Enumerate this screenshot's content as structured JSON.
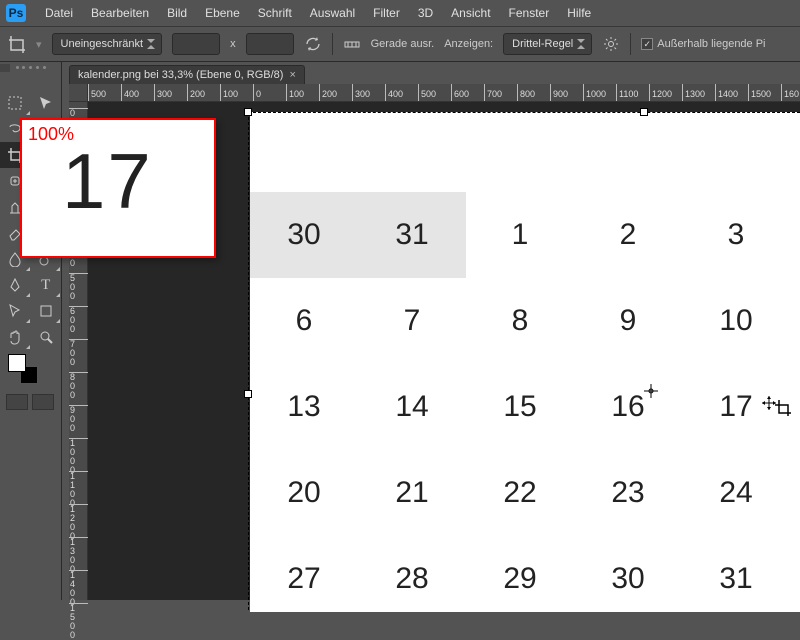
{
  "app_logo": "Ps",
  "menus": [
    "Datei",
    "Bearbeiten",
    "Bild",
    "Ebene",
    "Schrift",
    "Auswahl",
    "Filter",
    "3D",
    "Ansicht",
    "Fenster",
    "Hilfe"
  ],
  "optbar": {
    "ratio_label": "Uneingeschränkt",
    "x": "x",
    "straighten": "Gerade ausr.",
    "view_label": "Anzeigen:",
    "view_value": "Drittel-Regel",
    "outside_label": "Außerhalb liegende Pi"
  },
  "tab": {
    "title": "kalender.png bei 33,3% (Ebene 0, RGB/8)"
  },
  "ruler_h": [
    "500",
    "400",
    "300",
    "200",
    "100",
    "0",
    "100",
    "200",
    "300",
    "400",
    "500",
    "600",
    "700",
    "800",
    "900",
    "1000",
    "1100",
    "1200",
    "1300",
    "1400",
    "1500",
    "160"
  ],
  "ruler_v": [
    "0",
    "100",
    "200",
    "300",
    "400",
    "500",
    "600",
    "700",
    "800",
    "900",
    "1000",
    "1100",
    "1200",
    "1300",
    "1400",
    "1500"
  ],
  "navigator": {
    "zoom": "100%",
    "preview_number": "17"
  },
  "calendar": {
    "rows": [
      [
        "30",
        "31",
        "1",
        "2",
        "3"
      ],
      [
        "6",
        "7",
        "8",
        "9",
        "10"
      ],
      [
        "13",
        "14",
        "15",
        "16",
        "17"
      ],
      [
        "20",
        "21",
        "22",
        "23",
        "24"
      ],
      [
        "27",
        "28",
        "29",
        "30",
        "31"
      ]
    ],
    "grey_cols_row0": [
      0,
      1
    ]
  },
  "tools": [
    [
      "move",
      "rect-marquee"
    ],
    [
      "lasso",
      "quick-select"
    ],
    [
      "crop",
      "eyedropper"
    ],
    [
      "healing",
      "brush"
    ],
    [
      "clone",
      "history-brush"
    ],
    [
      "eraser",
      "gradient"
    ],
    [
      "blur",
      "dodge"
    ],
    [
      "pen",
      "type"
    ],
    [
      "path-select",
      "rectangle"
    ],
    [
      "hand",
      "zoom"
    ]
  ],
  "swatch": {
    "fg": "#ffffff",
    "bg": "#000000"
  }
}
